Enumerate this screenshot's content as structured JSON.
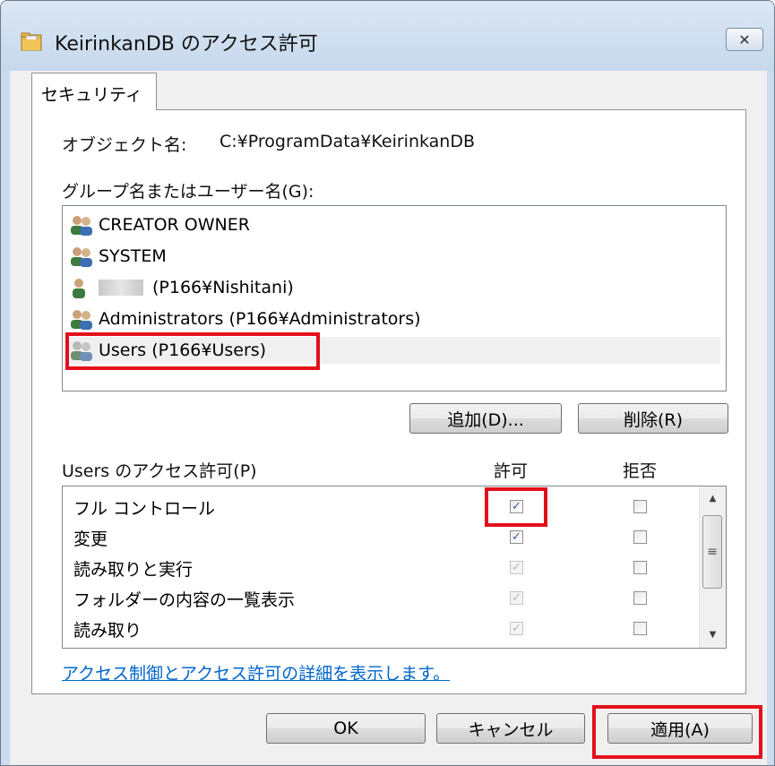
{
  "window": {
    "title": "KeirinkanDB のアクセス許可",
    "close_glyph": "✕"
  },
  "tab": {
    "label": "セキュリティ"
  },
  "object": {
    "label": "オブジェクト名:",
    "path": "C:¥ProgramData¥KeirinkanDB"
  },
  "groups": {
    "label": "グループ名またはユーザー名(G):",
    "items": [
      {
        "name": "CREATOR OWNER",
        "icon": "group-icon"
      },
      {
        "name": "SYSTEM",
        "icon": "group-icon"
      },
      {
        "name": "(P166¥Nishitani)",
        "icon": "user-icon"
      },
      {
        "name": "Administrators (P166¥Administrators)",
        "icon": "group-icon"
      },
      {
        "name": "Users (P166¥Users)",
        "icon": "group-icon",
        "selected": true
      }
    ]
  },
  "buttons": {
    "add": "追加(D)...",
    "remove": "削除(R)",
    "ok": "OK",
    "cancel": "キャンセル",
    "apply": "適用(A)"
  },
  "permissions": {
    "label": "Users のアクセス許可(P)",
    "allow_header": "許可",
    "deny_header": "拒否",
    "rows": [
      {
        "name": "フル コントロール",
        "allow": true,
        "allow_disabled": false,
        "deny": false
      },
      {
        "name": "変更",
        "allow": true,
        "allow_disabled": false,
        "deny": false
      },
      {
        "name": "読み取りと実行",
        "allow": true,
        "allow_disabled": true,
        "deny": false
      },
      {
        "name": "フォルダーの内容の一覧表示",
        "allow": true,
        "allow_disabled": true,
        "deny": false
      },
      {
        "name": "読み取り",
        "allow": true,
        "allow_disabled": true,
        "deny": false
      }
    ]
  },
  "link": {
    "text": "アクセス制御とアクセス許可の詳細を表示します。"
  },
  "colors": {
    "highlight": "#e3101a",
    "link": "#0066cc",
    "title_bg": "#cbdcef"
  }
}
